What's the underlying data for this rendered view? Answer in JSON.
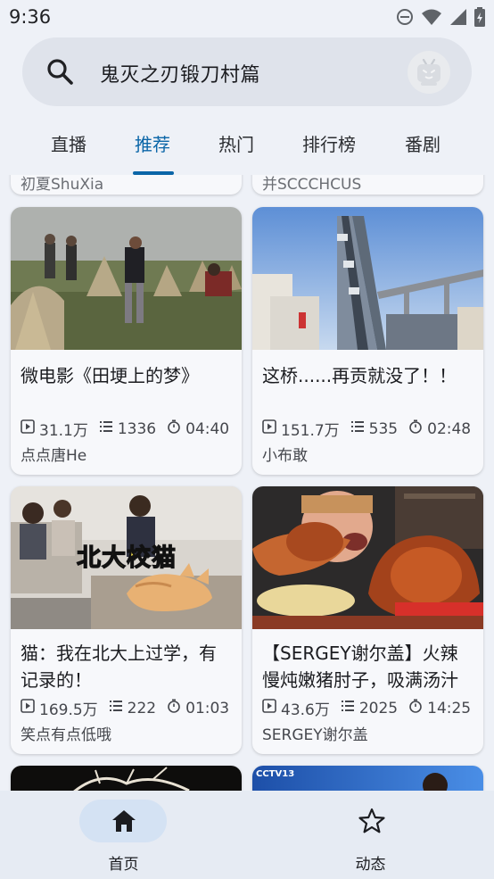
{
  "status": {
    "time": "9:36"
  },
  "search": {
    "query": "鬼灭之刃锻刀村篇"
  },
  "tabs": [
    {
      "label": "直播"
    },
    {
      "label": "推荐",
      "active": true
    },
    {
      "label": "热门"
    },
    {
      "label": "排行榜"
    },
    {
      "label": "番剧"
    }
  ],
  "partial_top": {
    "left_text": "初夏ShuXia",
    "right_text": "并SCCCHCUS"
  },
  "videos": [
    {
      "title": "微电影《田埂上的梦》",
      "views": "31.1万",
      "danmaku": "1336",
      "duration": "04:40",
      "author": "点点唐He",
      "thumb": "field"
    },
    {
      "title": "这桥......再贡就没了！！",
      "views": "151.7万",
      "danmaku": "535",
      "duration": "02:48",
      "author": "小布敢",
      "thumb": "bridge"
    },
    {
      "title": "猫：我在北大上过学，有记录的！",
      "views": "169.5万",
      "danmaku": "222",
      "duration": "01:03",
      "author": "笑点有点低哦",
      "thumb": "cat",
      "thumb_caption": "北大校猫"
    },
    {
      "title": "【SERGEY谢尔盖】火辣慢炖嫩猪肘子，吸满汤汁",
      "views": "43.6万",
      "danmaku": "2025",
      "duration": "14:25",
      "author": "SERGEY谢尔盖",
      "thumb": "food"
    }
  ],
  "partial_bottom": {
    "right_caption": "CCTV13"
  },
  "bottom_nav": [
    {
      "label": "首页",
      "icon": "home-icon",
      "active": true
    },
    {
      "label": "动态",
      "icon": "star-icon"
    }
  ],
  "colors": {
    "accent": "#0b66a8",
    "background": "#eef1f7",
    "card": "#f7f8fb",
    "search_bg": "#dfe3eb",
    "nav_pill": "#d4e2f3"
  }
}
